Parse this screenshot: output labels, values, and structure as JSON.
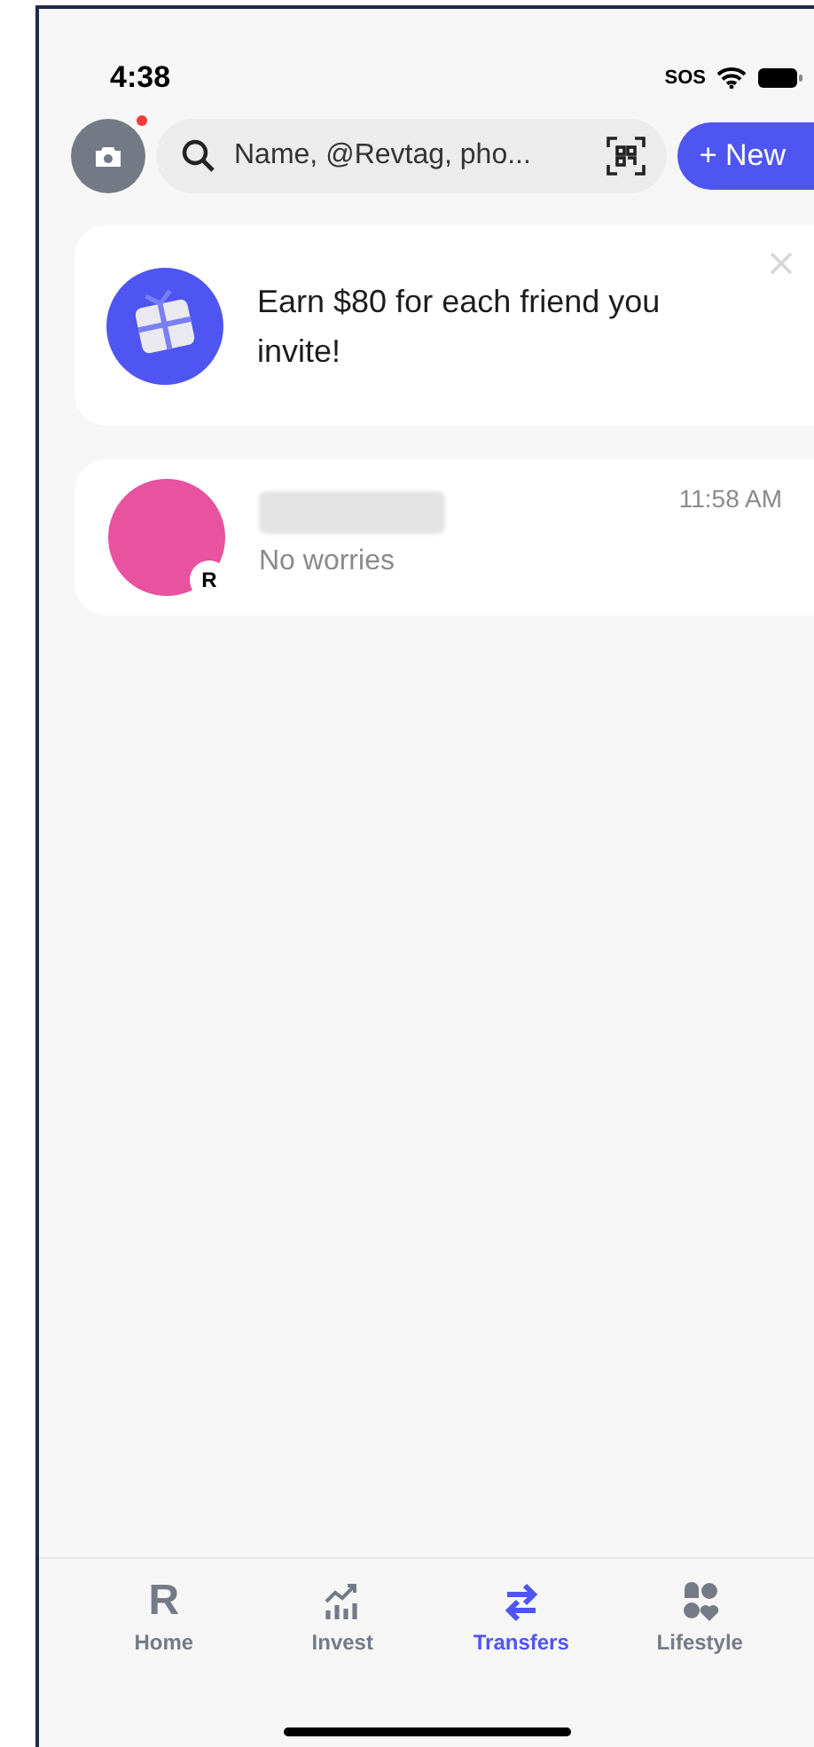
{
  "status_bar": {
    "time": "4:38",
    "sos": "SOS"
  },
  "top_bar": {
    "camera_notification": true,
    "search": {
      "placeholder": "Name, @Revtag, pho..."
    },
    "new_button": "+ New"
  },
  "promo": {
    "text": "Earn $80 for each friend you invite!",
    "dismissible": true
  },
  "chats": [
    {
      "name_redacted": true,
      "badge": "R",
      "time": "11:58 AM",
      "message": "No worries"
    }
  ],
  "tab_bar": [
    {
      "label": "Home",
      "kind": "home",
      "icon_text": "R",
      "selected": false
    },
    {
      "label": "Invest",
      "kind": "invest",
      "selected": false
    },
    {
      "label": "Transfers",
      "kind": "transfers",
      "selected": true
    },
    {
      "label": "Lifestyle",
      "kind": "lifestyle",
      "selected": false
    }
  ]
}
